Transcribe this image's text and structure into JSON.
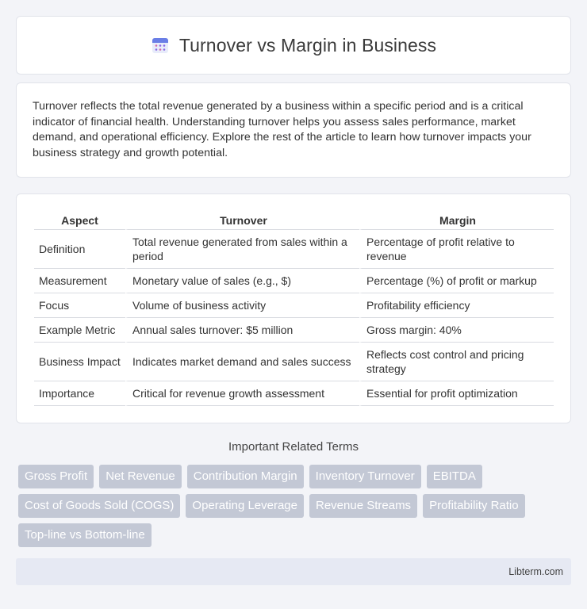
{
  "header": {
    "title": "Turnover vs Margin in Business",
    "icon": "calendar-icon"
  },
  "intro": {
    "text": "Turnover reflects the total revenue generated by a business within a specific period and is a critical indicator of financial health. Understanding turnover helps you assess sales performance, market demand, and operational efficiency. Explore the rest of the article to learn how turnover impacts your business strategy and growth potential."
  },
  "table": {
    "headers": [
      "Aspect",
      "Turnover",
      "Margin"
    ],
    "rows": [
      [
        "Definition",
        "Total revenue generated from sales within a period",
        "Percentage of profit relative to revenue"
      ],
      [
        "Measurement",
        "Monetary value of sales (e.g., $)",
        "Percentage (%) of profit or markup"
      ],
      [
        "Focus",
        "Volume of business activity",
        "Profitability efficiency"
      ],
      [
        "Example Metric",
        "Annual sales turnover: $5 million",
        "Gross margin: 40%"
      ],
      [
        "Business Impact",
        "Indicates market demand and sales success",
        "Reflects cost control and pricing strategy"
      ],
      [
        "Importance",
        "Critical for revenue growth assessment",
        "Essential for profit optimization"
      ]
    ]
  },
  "related": {
    "title": "Important Related Terms",
    "tags": [
      "Gross Profit",
      "Net Revenue",
      "Contribution Margin",
      "Inventory Turnover",
      "EBITDA",
      "Cost of Goods Sold (COGS)",
      "Operating Leverage",
      "Revenue Streams",
      "Profitability Ratio",
      "Top-line vs Bottom-line"
    ]
  },
  "footer": {
    "brand": "Libterm.com"
  },
  "colors": {
    "tag_bg": "#c3c8d5",
    "footer_bg": "#e6e9f3",
    "page_bg": "#f3f4f8"
  }
}
